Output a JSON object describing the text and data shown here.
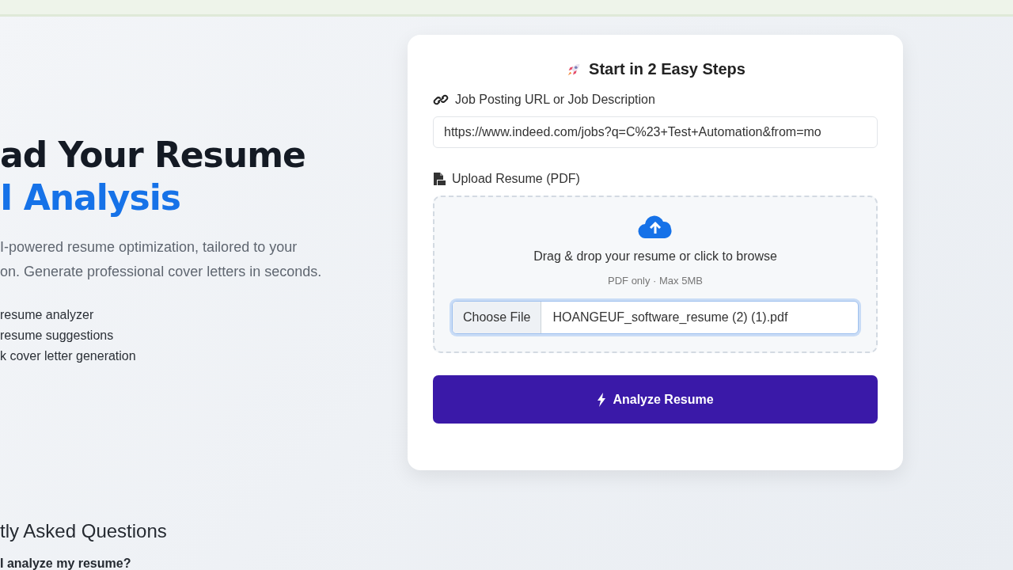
{
  "hero": {
    "title_line_1": "ad Your Resume",
    "title_line_2": "I Analysis",
    "description_lines": [
      "I-powered resume optimization, tailored to your",
      "on. Generate professional cover letters in seconds."
    ],
    "features": [
      "resume analyzer",
      "resume suggestions",
      "k cover letter generation"
    ]
  },
  "faq": {
    "title": "tly Asked Questions",
    "questions": [
      "I analyze my resume?"
    ]
  },
  "card": {
    "title": "Start in 2 Easy Steps",
    "job_field": {
      "label": "Job Posting URL or Job Description",
      "value": "https://www.indeed.com/jobs?q=C%23+Test+Automation&from=mo"
    },
    "upload": {
      "label": "Upload Resume (PDF)",
      "prompt": "Drag & drop your resume or click to browse",
      "hint": "PDF only · Max 5MB",
      "choose_button": "Choose File",
      "file_name": "HOANGEUF_software_resume (2) (1).pdf",
      "focused": true
    },
    "submit_button": "Analyze Resume"
  }
}
